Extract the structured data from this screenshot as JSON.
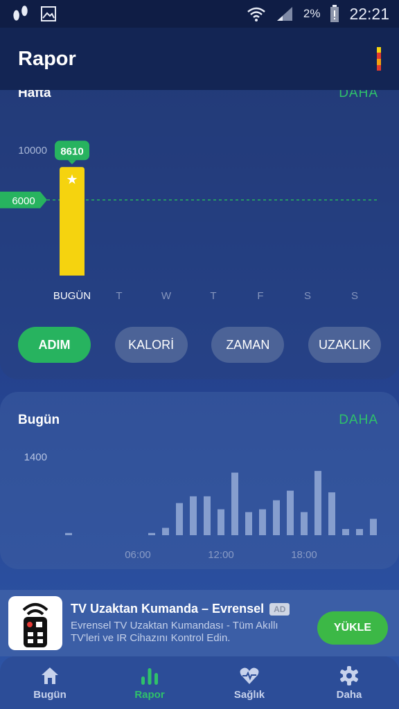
{
  "status_bar": {
    "time": "22:21",
    "battery_pct": "2%",
    "left_icons": [
      "footprints-icon",
      "image-icon"
    ],
    "right_icons": [
      "wifi-icon",
      "signal-icon",
      "battery-icon"
    ]
  },
  "app_bar": {
    "title": "Rapor",
    "menu_icon": "colored-bar-icon"
  },
  "week_card": {
    "title": "Hafta",
    "more_label": "DAHA",
    "chart_data": {
      "type": "bar",
      "categories": [
        "BUGÜN",
        "T",
        "W",
        "T",
        "F",
        "S",
        "S"
      ],
      "values": [
        8610,
        0,
        0,
        0,
        0,
        0,
        0
      ],
      "y_tick": "10000",
      "goal_label": "6000",
      "goal_value": 6000,
      "ylim": [
        0,
        13000
      ],
      "value_label": "8610",
      "bar_color": "#f5d30f",
      "goal_color": "#27b35f"
    },
    "chips": [
      {
        "label": "ADIM",
        "active": true
      },
      {
        "label": "KALORİ",
        "active": false
      },
      {
        "label": "ZAMAN",
        "active": false
      },
      {
        "label": "UZAKLIK",
        "active": false
      }
    ]
  },
  "day_card": {
    "title": "Bugün",
    "more_label": "DAHA",
    "chart_data": {
      "type": "bar",
      "y_tick": "1400",
      "ylim": [
        0,
        1400
      ],
      "x_ticks": [
        "06:00",
        "12:00",
        "18:00"
      ],
      "x_tick_hours": [
        6,
        12,
        18
      ],
      "hours": [
        0,
        1,
        2,
        3,
        4,
        5,
        6,
        7,
        8,
        9,
        10,
        11,
        12,
        13,
        14,
        15,
        16,
        17,
        18,
        19,
        20,
        21,
        22,
        23
      ],
      "values": [
        0,
        40,
        0,
        0,
        0,
        0,
        0,
        40,
        130,
        570,
        690,
        690,
        460,
        1110,
        410,
        460,
        620,
        790,
        410,
        1140,
        760,
        110,
        110,
        290
      ],
      "bar_color": "#8fa6d4"
    }
  },
  "ad": {
    "title": "TV Uzaktan Kumanda – Evrensel",
    "badge": "AD",
    "description": "Evrensel TV Uzaktan Kumandası - Tüm Akıllı TV'leri ve IR Cihazını Kontrol Edin.",
    "button_label": "YÜKLE",
    "icon": "tv-remote-icon"
  },
  "bottom_nav": {
    "items": [
      {
        "label": "Bugün",
        "icon": "home-icon",
        "active": false
      },
      {
        "label": "Rapor",
        "icon": "bar-chart-icon",
        "active": true
      },
      {
        "label": "Sağlık",
        "icon": "heart-pulse-icon",
        "active": false
      },
      {
        "label": "Daha",
        "icon": "gear-icon",
        "active": false
      }
    ]
  },
  "colors": {
    "accent_green": "#2fc16a",
    "bar_yellow": "#f5d30f"
  }
}
